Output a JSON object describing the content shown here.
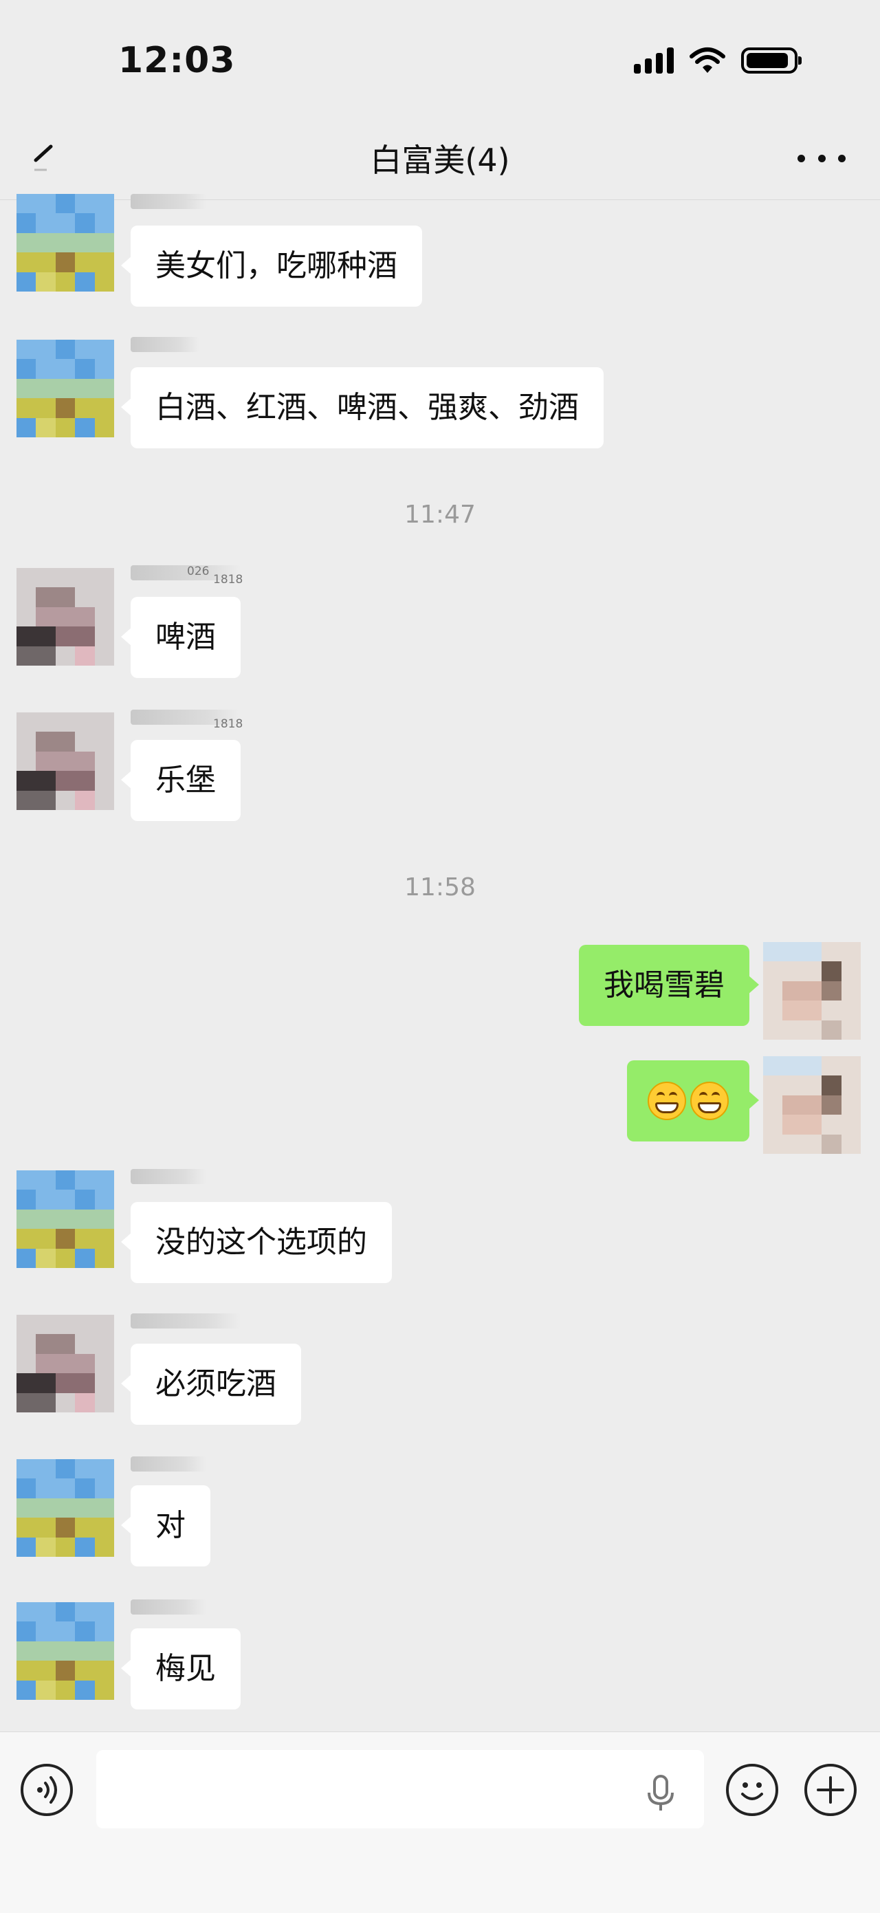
{
  "status_bar": {
    "time": "12:03"
  },
  "nav": {
    "title": "白富美(4)"
  },
  "timestamps": [
    "11:47",
    "11:58"
  ],
  "messages": [
    {
      "direction": "in",
      "avatar": "landscape-avatar",
      "text": "美女们，吃哪种酒"
    },
    {
      "direction": "in",
      "avatar": "landscape-avatar",
      "text": "白酒、红酒、啤酒、强爽、劲酒"
    },
    {
      "direction": "in",
      "avatar": "person-avatar",
      "sender_tag": "1818",
      "sender_prefix": "026",
      "text": "啤酒"
    },
    {
      "direction": "in",
      "avatar": "person-avatar",
      "sender_tag": "1818",
      "text": "乐堡"
    },
    {
      "direction": "out",
      "avatar": "self-avatar",
      "text": "我喝雪碧"
    },
    {
      "direction": "out",
      "avatar": "self-avatar",
      "text": "",
      "emoji": [
        "grinning-face",
        "grinning-face"
      ]
    },
    {
      "direction": "in",
      "avatar": "landscape-avatar",
      "text": "没的这个选项的"
    },
    {
      "direction": "in",
      "avatar": "person-avatar",
      "text": "必须吃酒"
    },
    {
      "direction": "in",
      "avatar": "landscape-avatar",
      "text": "对"
    },
    {
      "direction": "in",
      "avatar": "landscape-avatar",
      "text": "梅见"
    }
  ],
  "input": {
    "value": ""
  },
  "colors": {
    "background": "#ededed",
    "incoming_bubble": "#ffffff",
    "outgoing_bubble": "#95ec69",
    "timestamp": "#9a9a9a"
  }
}
